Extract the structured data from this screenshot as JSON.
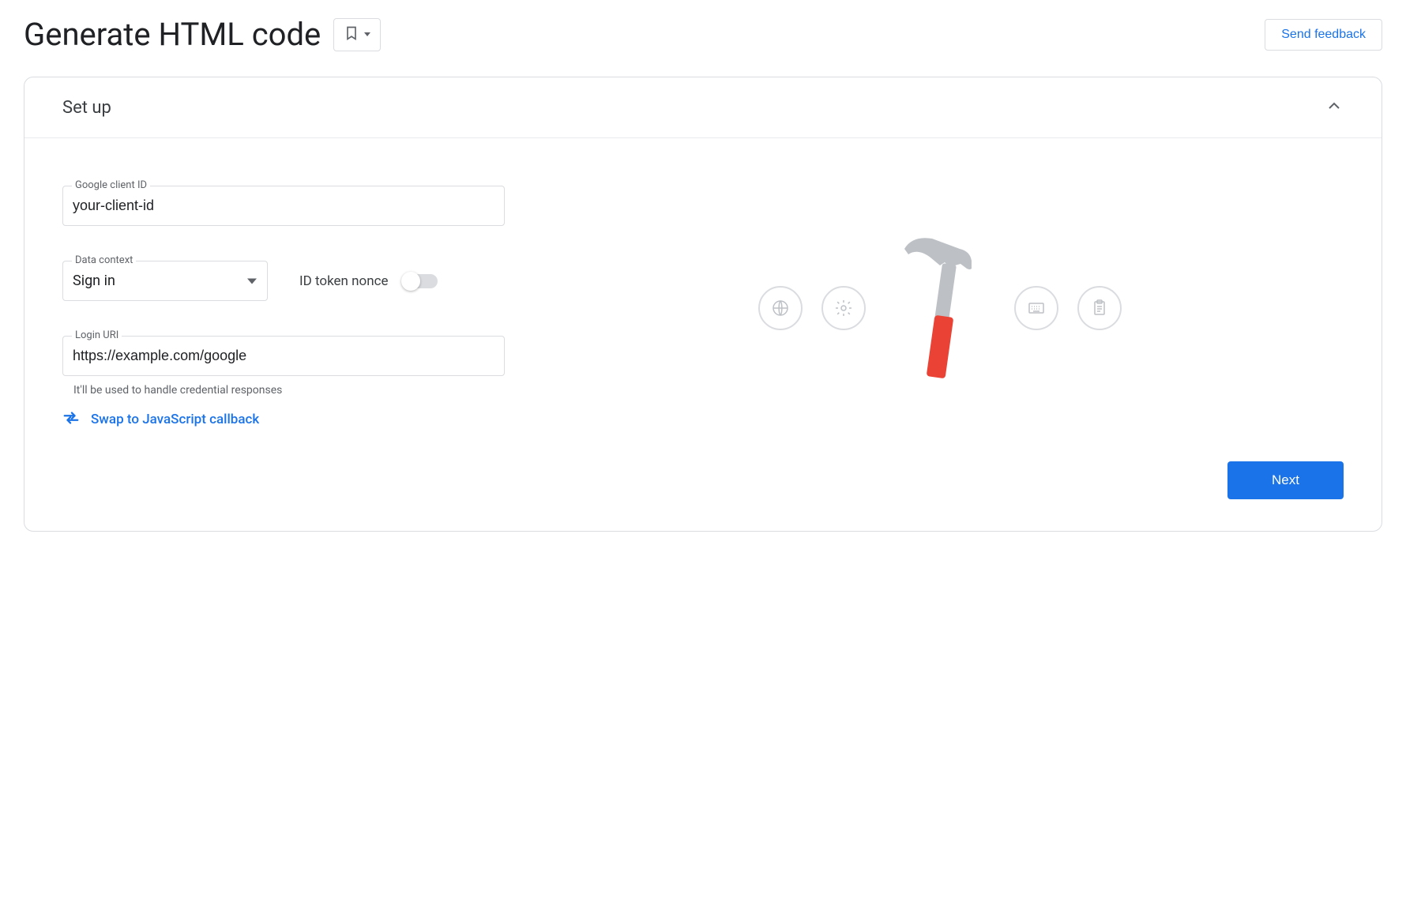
{
  "header": {
    "title": "Generate HTML code",
    "feedback_label": "Send feedback"
  },
  "card": {
    "title": "Set up",
    "next_label": "Next"
  },
  "form": {
    "client_id": {
      "label": "Google client ID",
      "value": "your-client-id"
    },
    "data_context": {
      "label": "Data context",
      "value": "Sign in"
    },
    "nonce": {
      "label": "ID token nonce",
      "enabled": false
    },
    "login_uri": {
      "label": "Login URI",
      "value": "https://example.com/google",
      "helper": "It'll be used to handle credential responses"
    },
    "swap_link": "Swap to JavaScript callback"
  }
}
